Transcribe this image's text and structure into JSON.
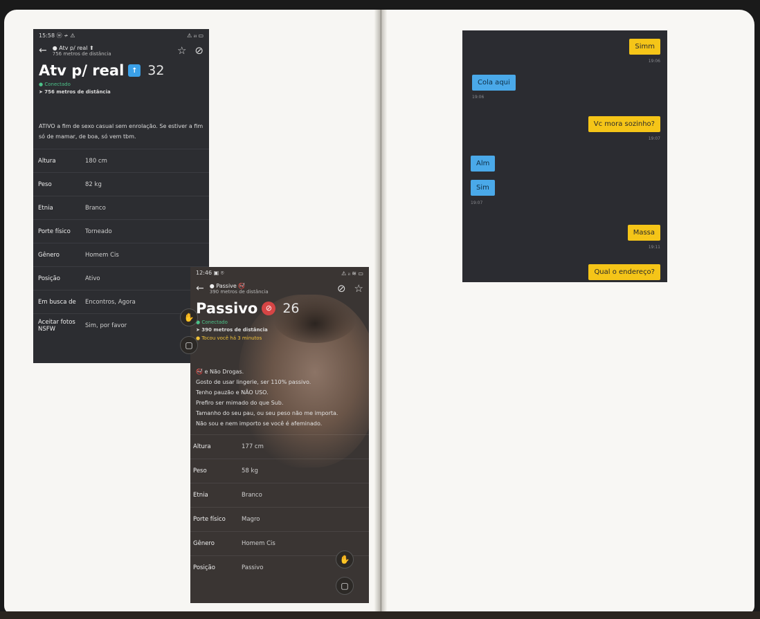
{
  "shot1": {
    "status_time": "15:58 ⓦ ≁ ⚠",
    "status_right": "⚠ ᵢₗₗ ▭",
    "topbar_title": "● Atv p/ real ⬆",
    "topbar_sub": "756 metros de distância",
    "name": "Atv p/ real",
    "top_badge": "TOP",
    "age": "32",
    "online": "● Conectado",
    "distance": "➤ 756 metros de distância",
    "bio": "ATIVO a fim de sexo casual sem enrolação. Se estiver a fim só de mamar, de boa, só vem tbm.",
    "rows": [
      {
        "k": "Altura",
        "v": "180 cm"
      },
      {
        "k": "Peso",
        "v": "82 kg"
      },
      {
        "k": "Etnia",
        "v": "Branco"
      },
      {
        "k": "Porte físico",
        "v": "Torneado"
      },
      {
        "k": "Gênero",
        "v": "Homem Cis"
      },
      {
        "k": "Posição",
        "v": "Ativo"
      },
      {
        "k": "Em busca de",
        "v": "Encontros, Agora"
      },
      {
        "k": "Aceitar fotos NSFW",
        "v": "Sim, por favor"
      }
    ]
  },
  "shot2": {
    "status_time": "12:46 ▣ ⌾",
    "status_right": "⚠ ᵢₗ ≋ ▭",
    "topbar_title": "● Passive 🚭",
    "topbar_sub": "390 metros de distância",
    "name": "Passivo",
    "age": "26",
    "online": "● Conectado",
    "distance": "➤ 390 metros de distância",
    "tapped": "● Tocou você há 3 minutos",
    "bio_lines": [
      "🚭 e Não Drogas.",
      "Gosto de usar lingerie, ser 110% passivo.",
      "Tenho pauzão e NÃO USO.",
      "Prefiro ser mimado do que Sub.",
      "Tamanho do seu pau, ou seu peso não me importa.",
      "Não sou e nem importo se você é afeminado."
    ],
    "rows": [
      {
        "k": "Altura",
        "v": "177 cm"
      },
      {
        "k": "Peso",
        "v": "58 kg"
      },
      {
        "k": "Etnia",
        "v": "Branco"
      },
      {
        "k": "Porte físico",
        "v": "Magro"
      },
      {
        "k": "Gênero",
        "v": "Homem Cis"
      },
      {
        "k": "Posição",
        "v": "Passivo"
      }
    ]
  },
  "chat": {
    "messages": [
      {
        "dir": "out",
        "text": "Simm",
        "time": "19:06"
      },
      {
        "dir": "in",
        "text": "Cola aqui",
        "time": "19:06"
      },
      {
        "dir": "out",
        "text": "Vc mora sozinho?",
        "time": "19:07"
      },
      {
        "dir": "in",
        "text": "Alm",
        "time": ""
      },
      {
        "dir": "in",
        "text": "Sim",
        "time": "19:07"
      },
      {
        "dir": "out",
        "text": "Massa",
        "time": "19:11"
      },
      {
        "dir": "out",
        "text": "Qual o endereço?",
        "time": ""
      }
    ]
  },
  "colors": {
    "chat_out": "#f5c518",
    "chat_in": "#4aa9e9",
    "online": "#4cc38a",
    "tapped": "#f0c23a",
    "top_badge": "#3aa0e8"
  }
}
